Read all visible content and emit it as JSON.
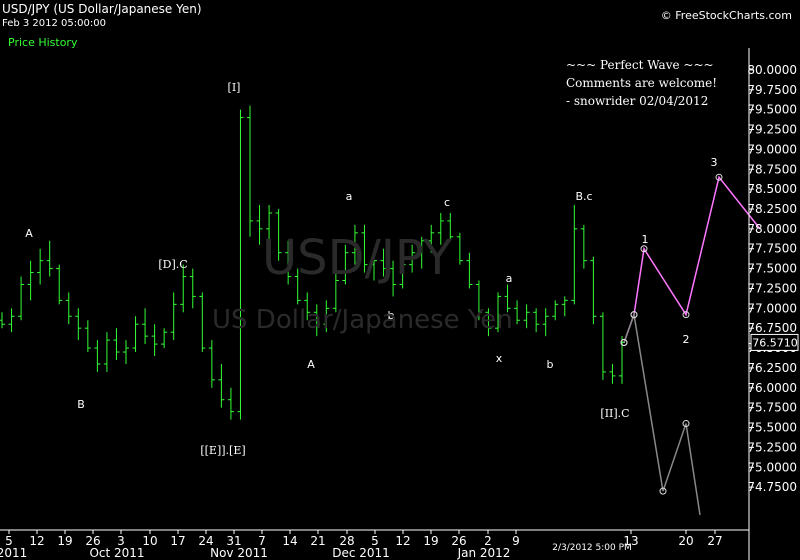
{
  "header": {
    "symbol_title": "USD/JPY (US Dollar/Japanese Yen)",
    "bar_date": "Feb 3 2012 05:00:00",
    "panel_label": "Price History",
    "site_credit": "© FreeStockCharts.com"
  },
  "watermark": {
    "symbol": "USD/JPY",
    "name": "US Dollar/Japanese Yen"
  },
  "note": {
    "line1": "~~~ Perfect Wave ~~~",
    "line2": "Comments are welcome!",
    "line3": "- snowrider  02/04/2012"
  },
  "colors": {
    "background": "#000000",
    "candle": "#33ff33",
    "bullish_projection": "#ff77ff",
    "bearish_projection": "#888888",
    "axis": "#ffffff",
    "text": "#ffffff"
  },
  "chart_data": {
    "type": "candlestick",
    "ylim": [
      74.5,
      80.15
    ],
    "y_ticks": [
      "80.0000",
      "79.7500",
      "79.5000",
      "79.2500",
      "79.0000",
      "78.7500",
      "78.5000",
      "78.2500",
      "78.0000",
      "77.7500",
      "77.5000",
      "77.2500",
      "77.0000",
      "76.7500",
      "76.5000",
      "76.2500",
      "76.0000",
      "75.7500",
      "75.5000",
      "75.2500",
      "75.0000",
      "74.7500"
    ],
    "x_ticks": [
      "5",
      "12",
      "19",
      "26",
      "3",
      "10",
      "17",
      "24",
      "31",
      "7",
      "14",
      "21",
      "28",
      "5",
      "12",
      "19",
      "26",
      "2",
      "9",
      "13",
      "20",
      "27"
    ],
    "month_labels": [
      "2011",
      "Oct 2011",
      "Nov 2011",
      "Dec 2011",
      "Jan 2012"
    ],
    "last_bar_time": "2/3/2012 5:00 PM",
    "last_price": "76.5710",
    "ohlc": [
      [
        76.85,
        76.95,
        76.75,
        76.8
      ],
      [
        76.8,
        77.0,
        76.7,
        76.9
      ],
      [
        76.9,
        77.4,
        76.85,
        77.3
      ],
      [
        77.3,
        77.6,
        77.1,
        77.45
      ],
      [
        77.45,
        77.75,
        77.3,
        77.6
      ],
      [
        77.6,
        77.85,
        77.4,
        77.5
      ],
      [
        77.5,
        77.55,
        77.05,
        77.1
      ],
      [
        77.1,
        77.2,
        76.8,
        76.9
      ],
      [
        76.9,
        77.0,
        76.6,
        76.75
      ],
      [
        76.75,
        76.85,
        76.45,
        76.5
      ],
      [
        76.5,
        76.6,
        76.2,
        76.3
      ],
      [
        76.3,
        76.7,
        76.2,
        76.6
      ],
      [
        76.6,
        76.75,
        76.35,
        76.45
      ],
      [
        76.45,
        76.6,
        76.3,
        76.5
      ],
      [
        76.5,
        76.9,
        76.45,
        76.8
      ],
      [
        76.8,
        77.0,
        76.55,
        76.65
      ],
      [
        76.65,
        76.8,
        76.4,
        76.55
      ],
      [
        76.55,
        76.75,
        76.5,
        76.7
      ],
      [
        76.7,
        77.2,
        76.6,
        77.05
      ],
      [
        77.05,
        77.55,
        76.95,
        77.4
      ],
      [
        77.4,
        77.5,
        77.0,
        77.15
      ],
      [
        77.15,
        77.2,
        76.45,
        76.5
      ],
      [
        76.5,
        76.6,
        76.0,
        76.1
      ],
      [
        76.1,
        76.3,
        75.75,
        75.85
      ],
      [
        75.85,
        76.0,
        75.6,
        75.7
      ],
      [
        75.7,
        79.5,
        75.6,
        79.4
      ],
      [
        79.4,
        79.55,
        77.9,
        78.1
      ],
      [
        78.1,
        78.3,
        77.8,
        78.0
      ],
      [
        78.0,
        78.3,
        77.85,
        78.2
      ],
      [
        78.2,
        78.25,
        77.6,
        77.7
      ],
      [
        77.7,
        77.85,
        77.3,
        77.4
      ],
      [
        77.4,
        77.5,
        77.05,
        77.1
      ],
      [
        77.1,
        77.2,
        76.85,
        76.95
      ],
      [
        76.95,
        77.05,
        76.65,
        76.8
      ],
      [
        76.8,
        77.1,
        76.7,
        77.0
      ],
      [
        77.0,
        77.45,
        76.95,
        77.35
      ],
      [
        77.35,
        77.8,
        77.3,
        77.7
      ],
      [
        77.7,
        78.05,
        77.55,
        77.95
      ],
      [
        77.95,
        78.05,
        77.45,
        77.55
      ],
      [
        77.55,
        77.75,
        77.35,
        77.6
      ],
      [
        77.6,
        77.75,
        77.4,
        77.5
      ],
      [
        77.5,
        77.6,
        77.15,
        77.3
      ],
      [
        77.3,
        77.65,
        77.25,
        77.55
      ],
      [
        77.55,
        77.8,
        77.45,
        77.7
      ],
      [
        77.7,
        77.9,
        77.5,
        77.85
      ],
      [
        77.85,
        78.05,
        77.7,
        77.95
      ],
      [
        77.95,
        78.2,
        77.8,
        78.1
      ],
      [
        78.1,
        78.2,
        77.85,
        77.9
      ],
      [
        77.9,
        77.95,
        77.55,
        77.6
      ],
      [
        77.6,
        77.7,
        77.25,
        77.3
      ],
      [
        77.3,
        77.35,
        76.85,
        76.95
      ],
      [
        76.95,
        77.0,
        76.65,
        76.75
      ],
      [
        76.75,
        77.2,
        76.7,
        77.15
      ],
      [
        77.15,
        77.3,
        76.95,
        77.0
      ],
      [
        77.0,
        77.1,
        76.8,
        76.85
      ],
      [
        76.85,
        77.05,
        76.75,
        76.95
      ],
      [
        76.95,
        77.0,
        76.7,
        76.8
      ],
      [
        76.8,
        77.0,
        76.65,
        76.9
      ],
      [
        76.9,
        77.1,
        76.85,
        77.05
      ],
      [
        77.05,
        77.15,
        76.9,
        77.1
      ],
      [
        77.1,
        78.3,
        77.05,
        78.0
      ],
      [
        78.0,
        78.05,
        77.5,
        77.6
      ],
      [
        77.6,
        77.65,
        76.8,
        76.9
      ],
      [
        76.9,
        76.95,
        76.1,
        76.2
      ],
      [
        76.2,
        76.3,
        76.05,
        76.15
      ],
      [
        76.15,
        76.65,
        76.05,
        76.57
      ]
    ],
    "wave_labels": [
      "[I]",
      "A",
      "B",
      "[D].C",
      "[[E]].[E]",
      "A",
      "a",
      "b",
      "c",
      "x",
      "a",
      "b",
      "B.c",
      "[II].C",
      "1",
      "2",
      "3"
    ],
    "bullish_projection": [
      76.57,
      76.92,
      77.75,
      76.92,
      78.65,
      78.0
    ],
    "bearish_projection": [
      76.57,
      76.92,
      74.7,
      75.55,
      74.4
    ]
  }
}
